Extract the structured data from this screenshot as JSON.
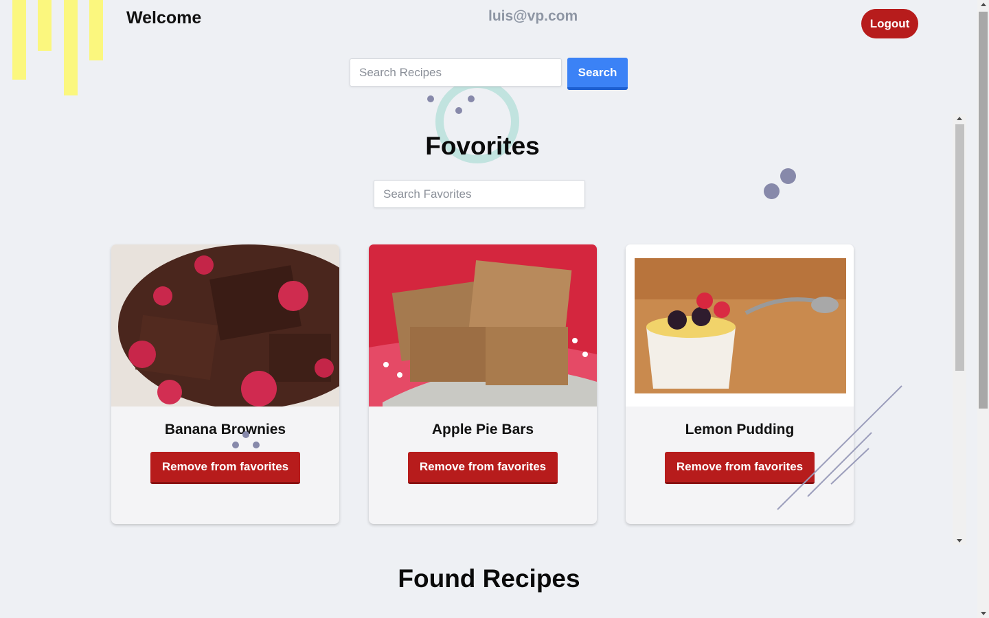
{
  "header": {
    "welcome": "Welcome",
    "email": "luis@vp.com",
    "logout_label": "Logout"
  },
  "search": {
    "placeholder": "Search Recipes",
    "button_label": "Search"
  },
  "favorites": {
    "title": "Fovorites",
    "search_placeholder": "Search Favorites",
    "cards": [
      {
        "title": "Banana Brownies",
        "button_label": "Remove from favorites"
      },
      {
        "title": "Apple Pie Bars",
        "button_label": "Remove from favorites"
      },
      {
        "title": "Lemon Pudding",
        "button_label": "Remove from favorites"
      }
    ]
  },
  "found": {
    "title": "Found Recipes"
  },
  "colors": {
    "background": "#eef0f4",
    "danger": "#b71c1c",
    "primary": "#3b82f6",
    "decor_yellow": "#fbf77e"
  }
}
